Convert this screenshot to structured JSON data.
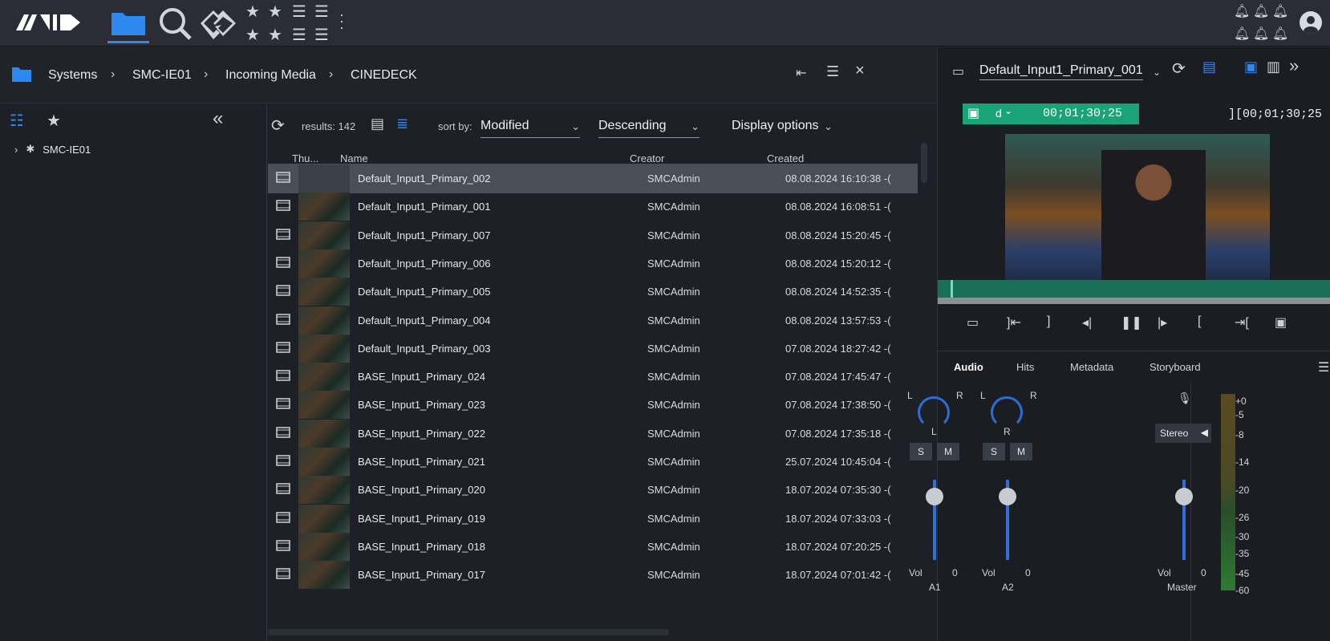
{
  "breadcrumb": [
    "Systems",
    "SMC-IE01",
    "Incoming Media",
    "CINEDECK"
  ],
  "tree": {
    "root_label": "SMC-IE01"
  },
  "results_text": "results: 142",
  "sort": {
    "label": "sort by:",
    "field": "Modified",
    "direction": "Descending",
    "display_options": "Display options"
  },
  "columns": [
    "Thu...",
    "Name",
    "Creator",
    "Created"
  ],
  "rows": [
    {
      "name": "Default_Input1_Primary_002",
      "creator": "SMCAdmin",
      "created": "08.08.2024 16:10:38 -(",
      "selected": true
    },
    {
      "name": "Default_Input1_Primary_001",
      "creator": "SMCAdmin",
      "created": "08.08.2024 16:08:51 -("
    },
    {
      "name": "Default_Input1_Primary_007",
      "creator": "SMCAdmin",
      "created": "08.08.2024 15:20:45 -("
    },
    {
      "name": "Default_Input1_Primary_006",
      "creator": "SMCAdmin",
      "created": "08.08.2024 15:20:12 -("
    },
    {
      "name": "Default_Input1_Primary_005",
      "creator": "SMCAdmin",
      "created": "08.08.2024 14:52:35 -("
    },
    {
      "name": "Default_Input1_Primary_004",
      "creator": "SMCAdmin",
      "created": "08.08.2024 13:57:53 -("
    },
    {
      "name": "Default_Input1_Primary_003",
      "creator": "SMCAdmin",
      "created": "07.08.2024 18:27:42 -("
    },
    {
      "name": "BASE_Input1_Primary_024",
      "creator": "SMCAdmin",
      "created": "07.08.2024 17:45:47 -("
    },
    {
      "name": "BASE_Input1_Primary_023",
      "creator": "SMCAdmin",
      "created": "07.08.2024 17:38:50 -("
    },
    {
      "name": "BASE_Input1_Primary_022",
      "creator": "SMCAdmin",
      "created": "07.08.2024 17:35:18 -("
    },
    {
      "name": "BASE_Input1_Primary_021",
      "creator": "SMCAdmin",
      "created": "25.07.2024 10:45:04 -("
    },
    {
      "name": "BASE_Input1_Primary_020",
      "creator": "SMCAdmin",
      "created": "18.07.2024 07:35:30 -("
    },
    {
      "name": "BASE_Input1_Primary_019",
      "creator": "SMCAdmin",
      "created": "18.07.2024 07:33:03 -("
    },
    {
      "name": "BASE_Input1_Primary_018",
      "creator": "SMCAdmin",
      "created": "18.07.2024 07:20:25 -("
    },
    {
      "name": "BASE_Input1_Primary_017",
      "creator": "SMCAdmin",
      "created": "18.07.2024 07:01:42 -("
    }
  ],
  "player": {
    "title": "Default_Input1_Primary_001",
    "track_mode": "d",
    "timecode_in": "00;01;30;25",
    "timecode_out": "00;01;30;25"
  },
  "tabs": [
    "Audio",
    "Hits",
    "Metadata",
    "Storyboard"
  ],
  "mixer": {
    "channels": [
      {
        "label": "A1",
        "pan": "L",
        "vol_label": "Vol",
        "vol": "0"
      },
      {
        "label": "A2",
        "pan": "R",
        "vol_label": "Vol",
        "vol": "0"
      }
    ],
    "master": {
      "label": "Master",
      "mode": "Stereo",
      "vol_label": "Vol",
      "vol": "0"
    },
    "pan_ends": {
      "left": "L",
      "right": "R"
    },
    "solo": "S",
    "mute": "M",
    "scale": [
      "+0",
      "-5",
      "-8",
      "-14",
      "-20",
      "-26",
      "-30",
      "-35",
      "-45",
      "-60"
    ]
  },
  "colors": {
    "accent": "#2f87f0",
    "timecode": "#19a376",
    "timeline": "#1b6e58"
  }
}
